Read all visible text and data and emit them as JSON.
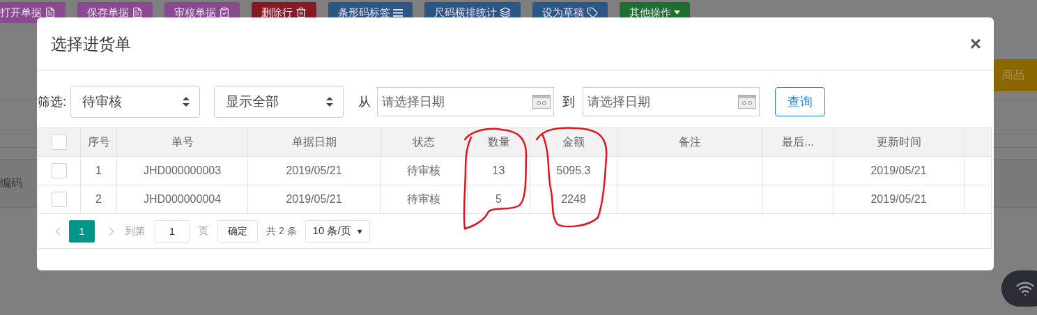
{
  "background": {
    "toolbar": [
      {
        "label": "打开单据",
        "color": "#8a4a90"
      },
      {
        "label": "保存单据",
        "color": "#8a4a90"
      },
      {
        "label": "审核单据",
        "color": "#8a4a90"
      },
      {
        "label": "删除行",
        "color": "#861a24"
      },
      {
        "label": "条形码标签",
        "color": "#2c5785"
      },
      {
        "label": "尺码横排统计",
        "color": "#2c5785"
      },
      {
        "label": "设为草稿",
        "color": "#2c5785"
      },
      {
        "label": "其他操作",
        "color": "#1e6e30"
      }
    ],
    "side_button": "商品",
    "left_label": "编码"
  },
  "dialog": {
    "title": "选择进货单",
    "close": "×",
    "filter": {
      "label": "筛选:",
      "status_select": "待审核",
      "scope_select": "显示全部",
      "from_label": "从",
      "from_date": {
        "placeholder": "请选择日期"
      },
      "to_label": "到",
      "to_date": {
        "placeholder": "请选择日期"
      },
      "query_button": "查询"
    },
    "table": {
      "all_checked": false,
      "columns": [
        "序号",
        "单号",
        "单据日期",
        "状态",
        "数量",
        "金额",
        "备注",
        "最后...",
        "更新时间"
      ],
      "rows": [
        {
          "checked": false,
          "cells": [
            "1",
            "JHD000000003",
            "2019/05/21",
            "待审核",
            "13",
            "5095.3",
            "",
            "",
            "2019/05/21"
          ]
        },
        {
          "checked": false,
          "cells": [
            "2",
            "JHD000000004",
            "2019/05/21",
            "待审核",
            "5",
            "2248",
            "",
            "",
            "2019/05/21"
          ]
        }
      ]
    },
    "pagination": {
      "pages": [
        {
          "label": "1",
          "selected": true
        }
      ],
      "goto_label": "到第",
      "goto_value": "1",
      "page_label": "页",
      "confirm_button": "确定",
      "total": "共 2 条",
      "page_size": "10 条/页",
      "page_size_caret": "▼"
    }
  }
}
